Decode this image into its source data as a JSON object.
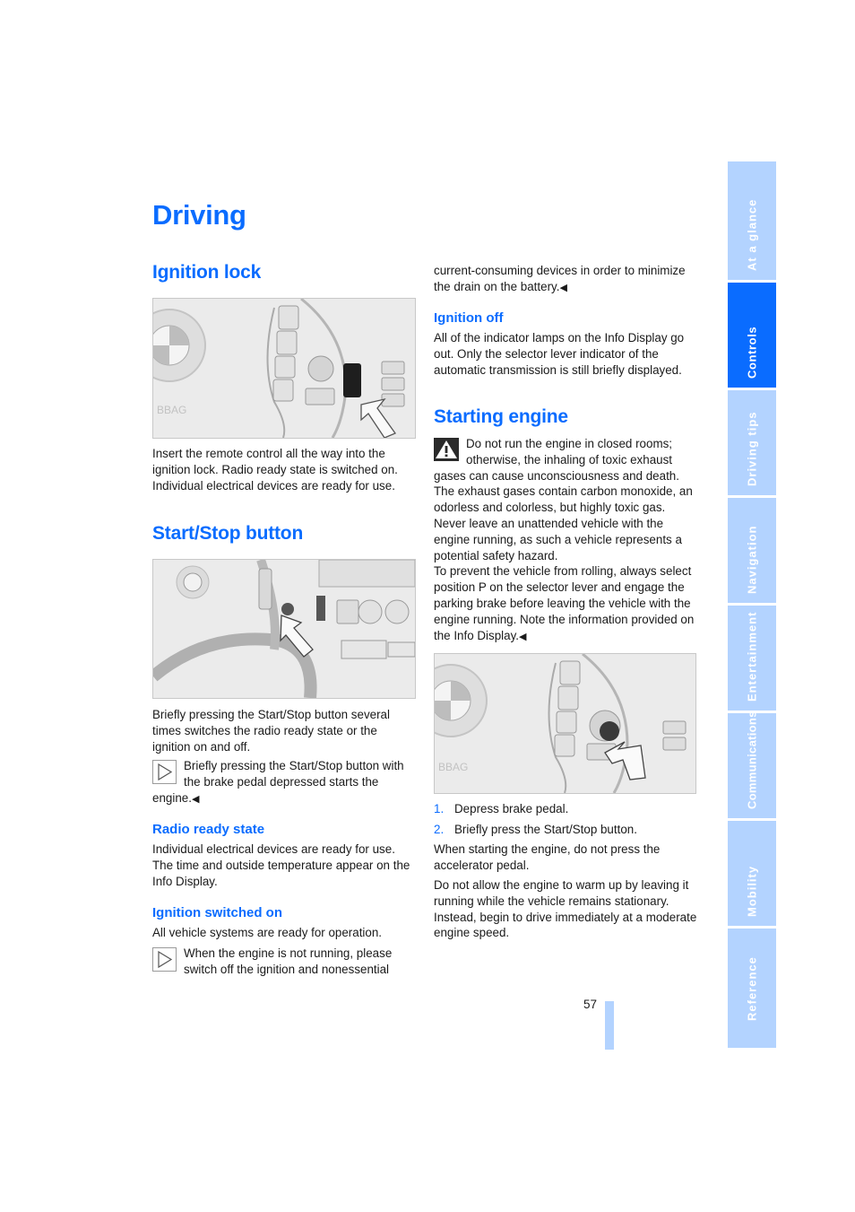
{
  "page": {
    "title": "Driving",
    "page_number": "57",
    "colors": {
      "accent": "#0a6cff",
      "tab_inactive": "#b3d3ff",
      "tab_active": "#0a6cff"
    }
  },
  "side_tabs": [
    {
      "label": "At a glance",
      "active": false
    },
    {
      "label": "Controls",
      "active": true
    },
    {
      "label": "Driving tips",
      "active": false
    },
    {
      "label": "Navigation",
      "active": false
    },
    {
      "label": "Entertainment",
      "active": false
    },
    {
      "label": "Communications",
      "active": false
    },
    {
      "label": "Mobility",
      "active": false
    },
    {
      "label": "Reference",
      "active": false
    }
  ],
  "left_column": {
    "ignition_lock": {
      "heading": "Ignition lock",
      "figure": "illustration-ignition-lock-remote-control",
      "text": "Insert the remote control all the way into the ignition lock. Radio ready state is switched on. Individual electrical devices are ready for use."
    },
    "start_stop": {
      "heading": "Start/Stop button",
      "figure": "illustration-start-stop-button",
      "text": "Briefly pressing the Start/Stop button several times switches the radio ready state or the ignition on and off.",
      "note": "Briefly pressing the Start/Stop button with the brake pedal depressed starts the engine.",
      "end_mark": "◀"
    },
    "radio_ready": {
      "heading": "Radio ready state",
      "text": "Individual electrical devices are ready for use. The time and outside temperature appear on the Info Display."
    },
    "ignition_on": {
      "heading": "Ignition switched on",
      "text": "All vehicle systems are ready for operation.",
      "note_start": "When the engine is not running, please switch off the ignition and nonessential"
    }
  },
  "right_column": {
    "note_continued": "current-consuming devices in order to minimize the drain on the battery.",
    "end_mark": "◀",
    "ignition_off": {
      "heading": "Ignition off",
      "text": "All of the indicator lamps on the Info Display go out. Only the selector lever indicator of the automatic transmission is still briefly displayed."
    },
    "starting_engine": {
      "heading": "Starting engine",
      "warning_1": "Do not run the engine in closed rooms; otherwise, the inhaling of toxic exhaust gases can cause unconsciousness and death. The exhaust gases contain carbon monoxide, an odorless and colorless, but highly toxic gas. Never leave an unattended vehicle with the engine running, as such a vehicle represents a potential safety hazard.",
      "warning_2": "To prevent the vehicle from rolling, always select position P on the selector lever and engage the parking brake before leaving the vehicle with the engine running. Note the information provided on the Info Display.",
      "figure": "illustration-start-stop-button-press",
      "steps": [
        {
          "num": "1.",
          "text": "Depress brake pedal."
        },
        {
          "num": "2.",
          "text": "Briefly press the Start/Stop button."
        }
      ],
      "para_1": "When starting the engine, do not press the accelerator pedal.",
      "para_2": "Do not allow the engine to warm up by leaving it running while the vehicle remains stationary. Instead, begin to drive immediately at a moderate engine speed."
    }
  }
}
